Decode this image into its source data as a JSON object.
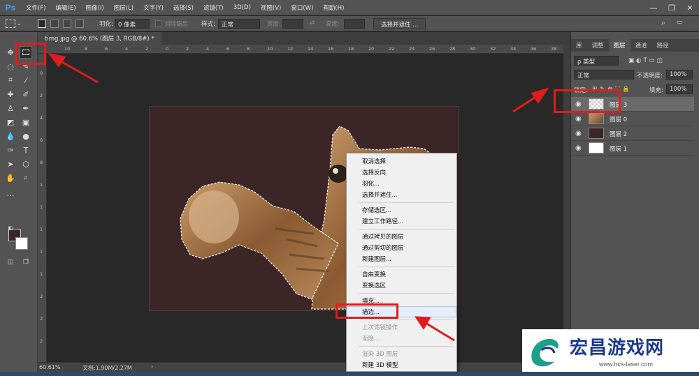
{
  "app": {
    "logo": "Ps"
  },
  "menubar": {
    "items": [
      "文件(F)",
      "编辑(E)",
      "图像(I)",
      "图层(L)",
      "文字(Y)",
      "选择(S)",
      "滤镜(T)",
      "3D(D)",
      "视图(V)",
      "窗口(W)",
      "帮助(H)"
    ]
  },
  "options": {
    "feather_label": "羽化:",
    "feather_value": "0 像素",
    "antialias_label": "消除锯齿",
    "style_label": "样式:",
    "style_value": "正常",
    "width_label": "宽度:",
    "height_label": "高度:",
    "select_mask_button": "选择并遮住 ..."
  },
  "document": {
    "tab_title": "timg.jpg @ 60.6% (图层 3, RGB/8#) *",
    "ruler_h": [
      "10",
      "8",
      "6",
      "4",
      "2",
      "0",
      "2",
      "4",
      "6",
      "8",
      "10",
      "12",
      "14",
      "16",
      "18",
      "20",
      "22",
      "24",
      "26",
      "28",
      "30",
      "32",
      "34",
      "36",
      "38"
    ],
    "ruler_v": [
      "0",
      "2",
      "4",
      "6",
      "8",
      "1",
      "1",
      "1",
      "1",
      "1",
      "2",
      "2",
      "2"
    ]
  },
  "status": {
    "zoom": "60.61%",
    "doc_info": "文档:1.90M/2.27M",
    "arrow": "›"
  },
  "right_panel": {
    "tabs": [
      "库",
      "调整",
      "图层",
      "通道",
      "路径"
    ],
    "active_tab": "图层",
    "kind_label": "ρ 类型",
    "blend_mode": "正常",
    "opacity_label": "不透明度:",
    "opacity_value": "100%",
    "lock_label": "锁定:",
    "fill_label": "填充:",
    "fill_value": "100%",
    "layers": [
      {
        "name": "图层 3",
        "selected": true
      },
      {
        "name": "图层 0",
        "selected": false
      },
      {
        "name": "图层 2",
        "selected": false
      },
      {
        "name": "图层 1",
        "selected": false
      }
    ]
  },
  "context_menu": {
    "items": [
      {
        "label": "取消选择",
        "disabled": false
      },
      {
        "label": "选择反向",
        "disabled": false
      },
      {
        "label": "羽化...",
        "disabled": false
      },
      {
        "label": "选择并遮住...",
        "disabled": false
      },
      {
        "label": "存储选区...",
        "disabled": false
      },
      {
        "label": "建立工作路径...",
        "disabled": false
      },
      {
        "label": "通过拷贝的图层",
        "disabled": false
      },
      {
        "label": "通过剪切的图层",
        "disabled": false
      },
      {
        "label": "新建图层...",
        "disabled": false
      },
      {
        "label": "自由变换",
        "disabled": false
      },
      {
        "label": "变换选区",
        "disabled": false
      },
      {
        "label": "填充...",
        "disabled": false
      },
      {
        "label": "描边...",
        "disabled": false
      },
      {
        "label": "上次滤镜操作",
        "disabled": true
      },
      {
        "label": "渐隐...",
        "disabled": true
      },
      {
        "label": "渲染 3D 图层",
        "disabled": true
      },
      {
        "label": "新建 3D 模型",
        "disabled": false
      }
    ]
  },
  "watermark": {
    "title": "宏昌游戏网",
    "url": "www.hcs-laser.com"
  },
  "colors": {
    "foreground": "#3c2526",
    "background": "#ffffff",
    "canvas_bg": "#3c2526",
    "annotation": "#e21b1b"
  }
}
